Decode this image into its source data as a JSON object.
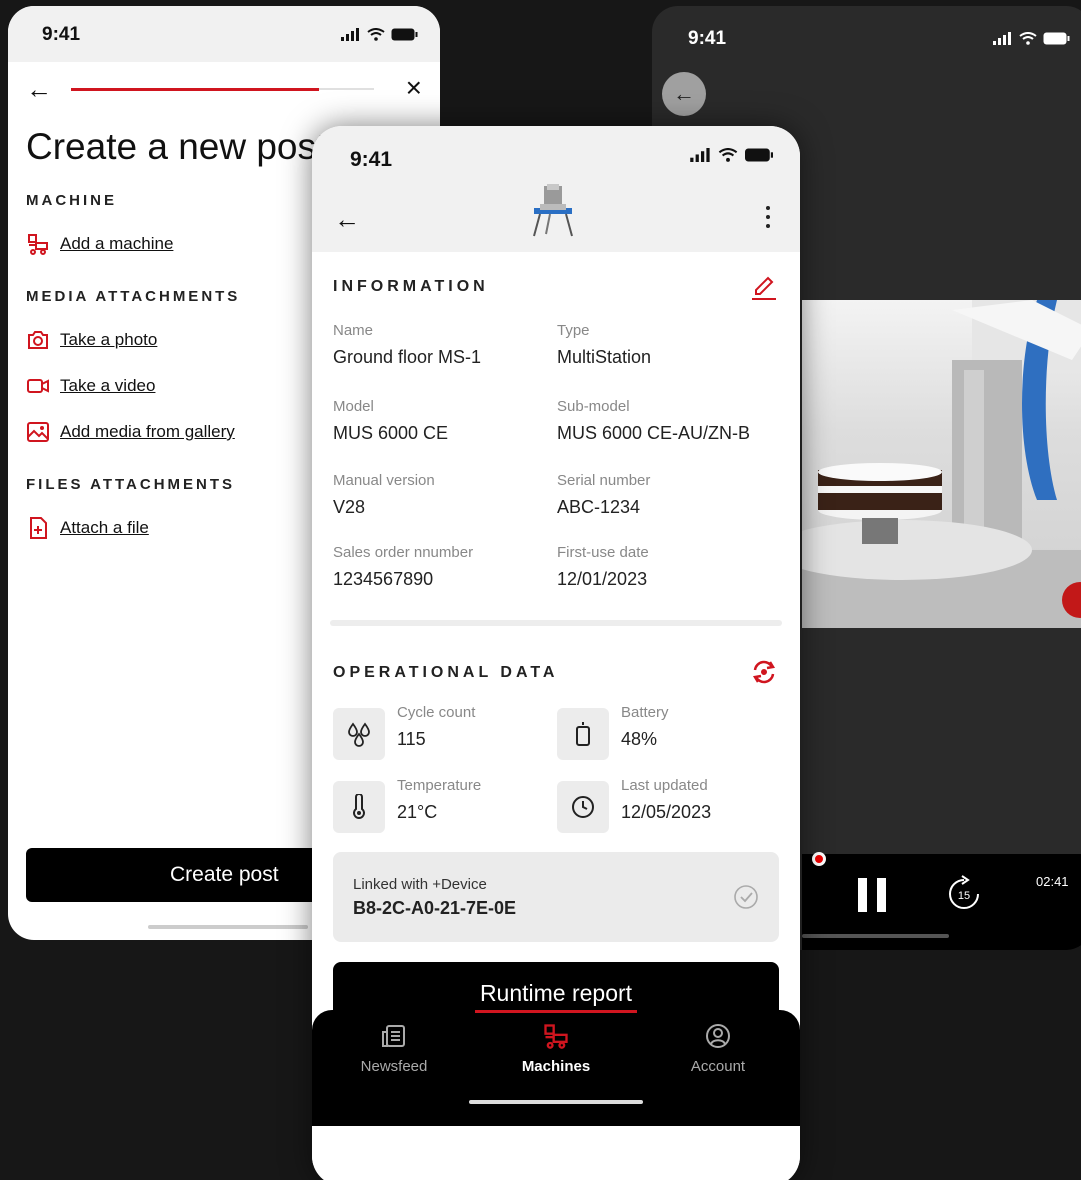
{
  "colors": {
    "accent": "#d0151f",
    "background": "#171717",
    "button": "#000000"
  },
  "left_screen": {
    "status_time": "9:41",
    "progress_fraction": 0.82,
    "title": "Create a new post",
    "sections": {
      "machine": "MACHINE",
      "media": "MEDIA ATTACHMENTS",
      "files": "FILES ATTACHMENTS"
    },
    "actions": {
      "add_machine": "Add a machine",
      "take_photo": "Take a photo",
      "take_video": "Take a video",
      "gallery": "Add media from gallery",
      "attach_file": "Attach a file"
    },
    "create_button": "Create post"
  },
  "right_screen": {
    "status_time": "9:41",
    "skip_seconds": "15",
    "video_time": "02:41"
  },
  "center_screen": {
    "status_time": "9:41",
    "information_title": "INFORMATION",
    "fields": [
      {
        "label": "Name",
        "value": "Ground floor MS-1"
      },
      {
        "label": "Type",
        "value": "MultiStation"
      },
      {
        "label": "Model",
        "value": "MUS 6000 CE"
      },
      {
        "label": "Sub-model",
        "value": "MUS 6000 CE-AU/ZN-B"
      },
      {
        "label": "Manual version",
        "value": "V28"
      },
      {
        "label": "Serial number",
        "value": "ABC-1234"
      },
      {
        "label": "Sales order nnumber",
        "value": "1234567890"
      },
      {
        "label": "First-use date",
        "value": "12/01/2023"
      }
    ],
    "operational_title": "OPERATIONAL DATA",
    "operational": [
      {
        "label": "Cycle count",
        "value": "115",
        "icon": "drops-icon"
      },
      {
        "label": "Battery",
        "value": "48%",
        "icon": "battery-icon"
      },
      {
        "label": "Temperature",
        "value": "21°C",
        "icon": "thermometer-icon"
      },
      {
        "label": "Last updated",
        "value": "12/05/2023",
        "icon": "clock-icon"
      }
    ],
    "linked": {
      "label": "Linked with +Device",
      "value": "B8-2C-A0-21-7E-0E"
    },
    "runtime_button": "Runtime report",
    "tabs": [
      {
        "label": "Newsfeed",
        "icon": "newsfeed-icon"
      },
      {
        "label": "Machines",
        "icon": "machines-icon"
      },
      {
        "label": "Account",
        "icon": "account-icon"
      }
    ]
  }
}
